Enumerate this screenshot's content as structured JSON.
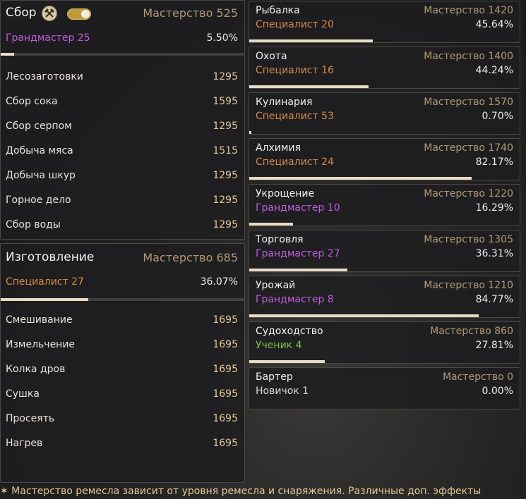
{
  "colors": {
    "grandmaster": "#c15be0",
    "specialist": "#d4884a",
    "apprentice": "#7cc24e",
    "novice": "#d6d6d6",
    "mastery": "#b09a74",
    "skill_value": "#e2c794",
    "progress_fill": "#e6dcc2"
  },
  "gathering": {
    "title": "Сбор",
    "icon": "crossed-tools-icon",
    "toggle": "on",
    "mastery": "Мастерство 525",
    "rank": "Грандмастер 25",
    "rank_tier": "grandmaster",
    "percent": "5.50%",
    "progress": 0.055,
    "skills": [
      {
        "label": "Лесозаготовки",
        "value": "1295"
      },
      {
        "label": "Сбор сока",
        "value": "1595"
      },
      {
        "label": "Сбор серпом",
        "value": "1295"
      },
      {
        "label": "Добыча мяса",
        "value": "1515"
      },
      {
        "label": "Добыча шкур",
        "value": "1295"
      },
      {
        "label": "Горное дело",
        "value": "1295"
      },
      {
        "label": "Сбор воды",
        "value": "1295"
      }
    ]
  },
  "crafting": {
    "title": "Изготовление",
    "mastery": "Мастерство 685",
    "rank": "Специалист 27",
    "rank_tier": "specialist",
    "percent": "36.07%",
    "progress": 0.3607,
    "skills": [
      {
        "label": "Смешивание",
        "value": "1695"
      },
      {
        "label": "Измельчение",
        "value": "1695"
      },
      {
        "label": "Колка дров",
        "value": "1695"
      },
      {
        "label": "Сушка",
        "value": "1695"
      },
      {
        "label": "Просеять",
        "value": "1695"
      },
      {
        "label": "Нагрев",
        "value": "1695"
      }
    ]
  },
  "lifeskills": [
    {
      "name": "Рыбалка",
      "mastery": "Мастерство 1420",
      "rank": "Специалист 20",
      "rank_tier": "specialist",
      "percent": "45.64%",
      "progress": 0.4564
    },
    {
      "name": "Охота",
      "mastery": "Мастерство 1400",
      "rank": "Специалист 16",
      "rank_tier": "specialist",
      "percent": "44.24%",
      "progress": 0.4424
    },
    {
      "name": "Кулинария",
      "mastery": "Мастерство 1570",
      "rank": "Специалист 53",
      "rank_tier": "specialist",
      "percent": "0.70%",
      "progress": 0.007
    },
    {
      "name": "Алхимия",
      "mastery": "Мастерство 1740",
      "rank": "Специалист 24",
      "rank_tier": "specialist",
      "percent": "82.17%",
      "progress": 0.8217
    },
    {
      "name": "Укрощение",
      "mastery": "Мастерство 1220",
      "rank": "Грандмастер 10",
      "rank_tier": "grandmaster",
      "percent": "16.29%",
      "progress": 0.1629
    },
    {
      "name": "Торговля",
      "mastery": "Мастерство 1305",
      "rank": "Грандмастер 27",
      "rank_tier": "grandmaster",
      "percent": "36.31%",
      "progress": 0.3631
    },
    {
      "name": "Урожай",
      "mastery": "Мастерство 1210",
      "rank": "Грандмастер 8",
      "rank_tier": "grandmaster",
      "percent": "84.77%",
      "progress": 0.8477
    },
    {
      "name": "Судоходство",
      "mastery": "Мастерство 860",
      "rank": "Ученик 4",
      "rank_tier": "apprentice",
      "percent": "27.81%",
      "progress": 0.2781
    },
    {
      "name": "Бартер",
      "mastery": "Мастерство 0",
      "rank": "Новичок 1",
      "rank_tier": "novice",
      "percent": "0.00%",
      "progress": 0.0
    }
  ],
  "footer_note": "✶ Мастерство ремесла зависит от уровня ремесла и снаряжения. Различные доп. эффекты"
}
